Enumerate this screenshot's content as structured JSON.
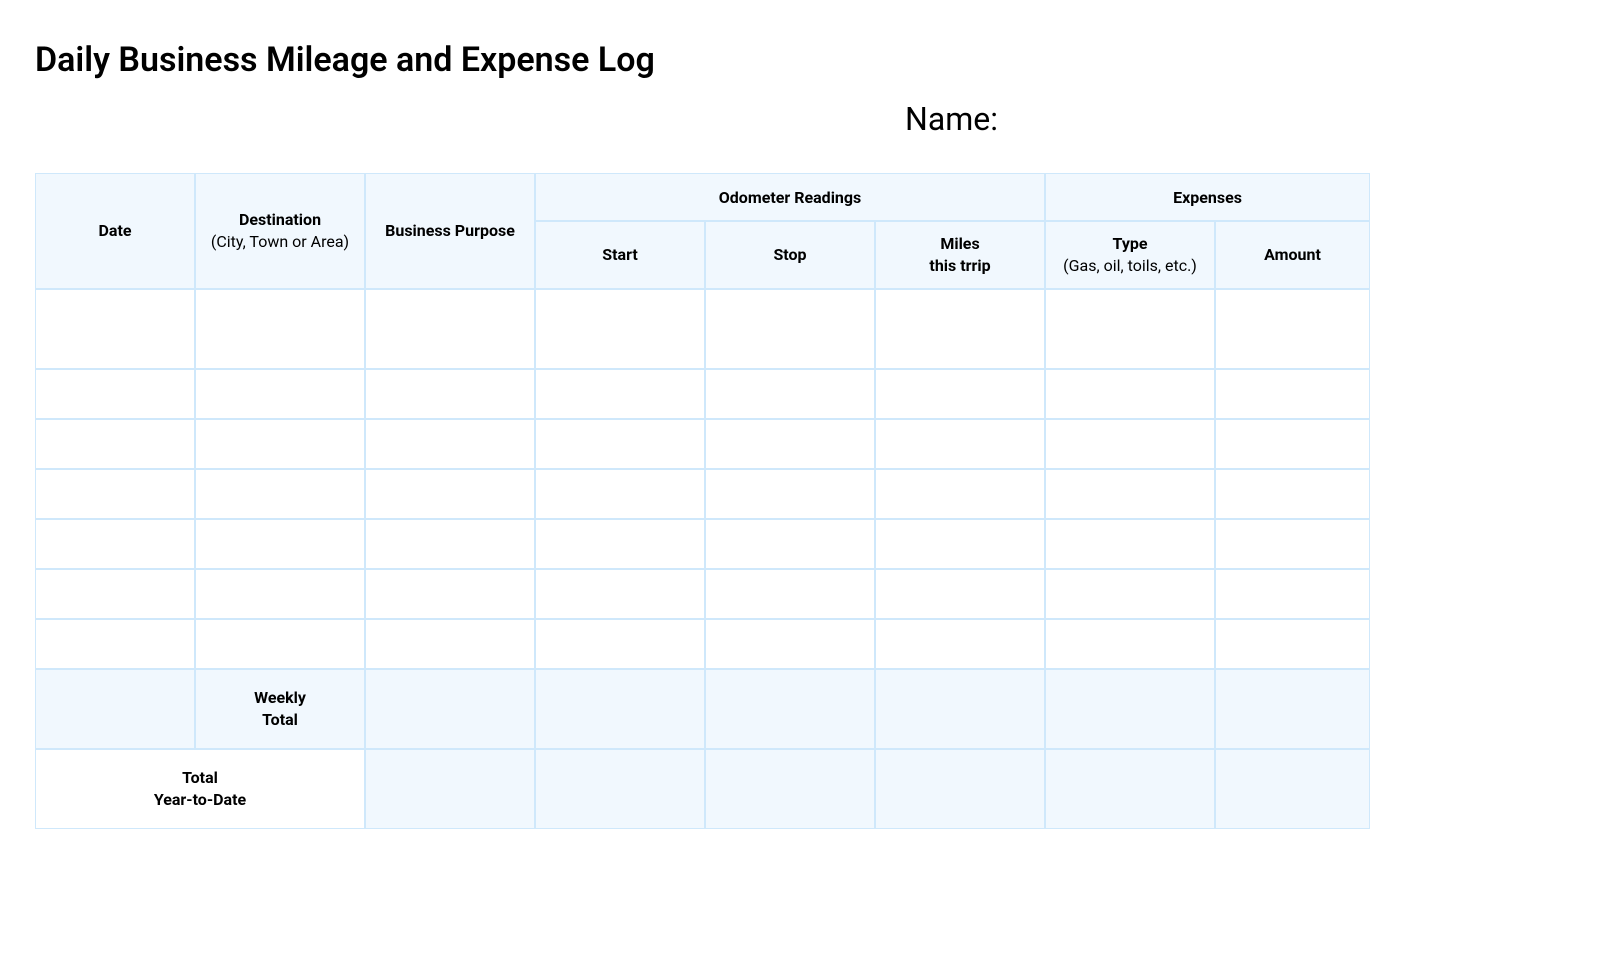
{
  "title": "Daily Business Mileage and Expense Log",
  "name_label": "Name:",
  "headers": {
    "date": "Date",
    "destination_line1": "Destination",
    "destination_line2": "(City, Town or Area)",
    "purpose": "Business Purpose",
    "odometer_group": "Odometer Readings",
    "expenses_group": "Expenses",
    "start": "Start",
    "stop": "Stop",
    "miles_line1": "Miles",
    "miles_line2": "this trrip",
    "type_line1": "Type",
    "type_line2": "(Gas, oil, toils, etc.)",
    "amount": "Amount"
  },
  "rows": [
    {
      "date": "",
      "destination": "",
      "purpose": "",
      "start": "",
      "stop": "",
      "miles": "",
      "type": "",
      "amount": ""
    },
    {
      "date": "",
      "destination": "",
      "purpose": "",
      "start": "",
      "stop": "",
      "miles": "",
      "type": "",
      "amount": ""
    },
    {
      "date": "",
      "destination": "",
      "purpose": "",
      "start": "",
      "stop": "",
      "miles": "",
      "type": "",
      "amount": ""
    },
    {
      "date": "",
      "destination": "",
      "purpose": "",
      "start": "",
      "stop": "",
      "miles": "",
      "type": "",
      "amount": ""
    },
    {
      "date": "",
      "destination": "",
      "purpose": "",
      "start": "",
      "stop": "",
      "miles": "",
      "type": "",
      "amount": ""
    },
    {
      "date": "",
      "destination": "",
      "purpose": "",
      "start": "",
      "stop": "",
      "miles": "",
      "type": "",
      "amount": ""
    },
    {
      "date": "",
      "destination": "",
      "purpose": "",
      "start": "",
      "stop": "",
      "miles": "",
      "type": "",
      "amount": ""
    }
  ],
  "weekly_total": {
    "label_line1": "Weekly",
    "label_line2": "Total",
    "purpose": "",
    "start": "",
    "stop": "",
    "miles": "",
    "type": "",
    "amount": ""
  },
  "ytd_total": {
    "label_line1": "Total",
    "label_line2": "Year-to-Date",
    "purpose": "",
    "start": "",
    "stop": "",
    "miles": "",
    "type": "",
    "amount": ""
  }
}
